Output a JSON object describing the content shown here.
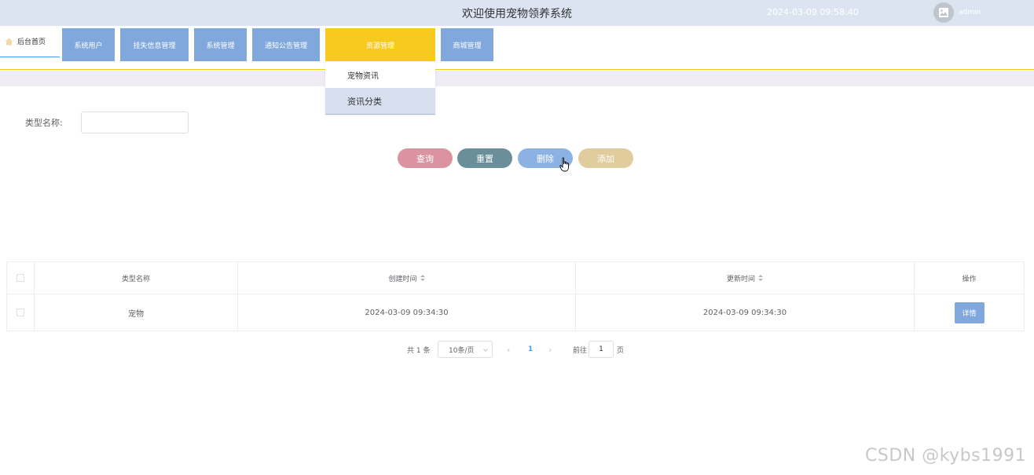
{
  "header": {
    "title": "欢迎使用宠物领养系统",
    "datetime": "2024-03-09 09:58:40",
    "username": "admin"
  },
  "nav": {
    "home_label": "后台首页",
    "menu": [
      {
        "label": "系统用户"
      },
      {
        "label": "挂失信息管理"
      },
      {
        "label": "系统管理"
      },
      {
        "label": "通知公告管理"
      },
      {
        "label": "资源管理",
        "active": true
      },
      {
        "label": "商城管理"
      }
    ],
    "submenu": [
      {
        "label": "宠物资讯"
      },
      {
        "label": "资讯分类"
      }
    ]
  },
  "search": {
    "label": "类型名称:",
    "value": ""
  },
  "actions": {
    "query": "查询",
    "reset": "重置",
    "delete": "删除",
    "add": "添加"
  },
  "table": {
    "columns": [
      "类型名称",
      "创建时间",
      "更新时间",
      "操作"
    ],
    "rows": [
      {
        "type_name": "宠物",
        "created": "2024-03-09 09:34:30",
        "updated": "2024-03-09 09:34:30",
        "action": "详情"
      }
    ]
  },
  "pagination": {
    "total": "共 1 条",
    "page_size": "10条/页",
    "current": "1",
    "goto": "前往",
    "goto_value": "1",
    "page_unit": "页"
  },
  "watermark": "CSDN @kybs1991",
  "colors": {
    "header_bg": "#dde4f1",
    "menu_bg": "#80a8dd",
    "menu_active": "#f8c91e",
    "query": "#dc93a1",
    "reset": "#6a8e9a",
    "delete": "#8cb2e3",
    "add": "#e0cc9c"
  }
}
